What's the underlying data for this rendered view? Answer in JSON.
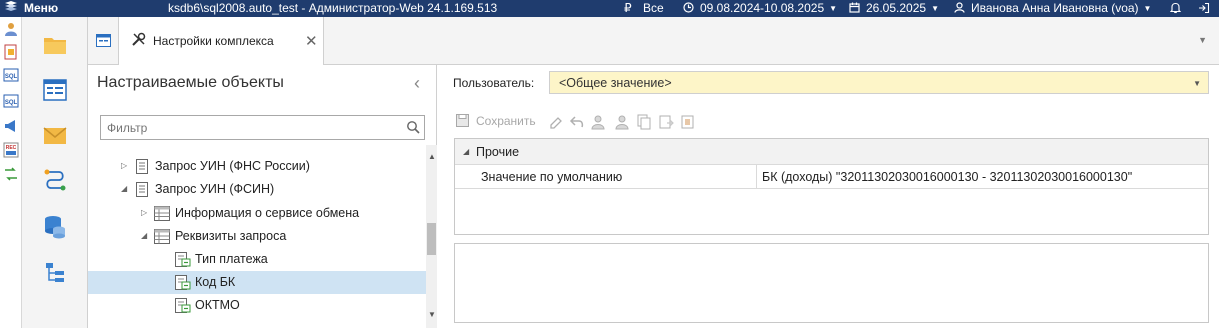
{
  "titlebar": {
    "menu_label": "Меню",
    "window_title": "ksdb6\\sql2008.auto_test - Администратор-Web 24.1.169.513",
    "currency_symbol": "₽",
    "currency_value": "Все",
    "period": "09.08.2024-10.08.2025",
    "date": "26.05.2025",
    "user": "Иванова Анна Ивановна (voa)"
  },
  "tab": {
    "label": "Настройки комплекса"
  },
  "tree_panel": {
    "title": "Настраиваемые объекты",
    "filter_placeholder": "Фильтр",
    "items": [
      {
        "label": "Запрос УИН (ФНС России)",
        "expanded": false,
        "icon": "document-icon"
      },
      {
        "label": "Запрос УИН (ФСИН)",
        "expanded": true,
        "icon": "document-icon"
      },
      {
        "label": "Информация о сервисе обмена",
        "expanded": false,
        "icon": "table-icon"
      },
      {
        "label": "Реквизиты запроса",
        "expanded": true,
        "icon": "table-icon"
      },
      {
        "label": "Тип платежа",
        "icon": "field-icon"
      },
      {
        "label": "Код БК",
        "icon": "field-icon",
        "selected": true
      },
      {
        "label": "ОКТМО",
        "icon": "field-icon"
      }
    ]
  },
  "settings": {
    "user_label": "Пользователь:",
    "user_value": "<Общее значение>",
    "save_label": "Сохранить",
    "group_label": "Прочие",
    "property_name": "Значение по умолчанию",
    "property_value": "БК (доходы) \"32011302030016000130 - 32011302030016000130\""
  },
  "colors": {
    "titlebar": "#1f3c6e",
    "selected_row": "#cfe3f3",
    "user_select_bg": "#fdf5c8"
  }
}
